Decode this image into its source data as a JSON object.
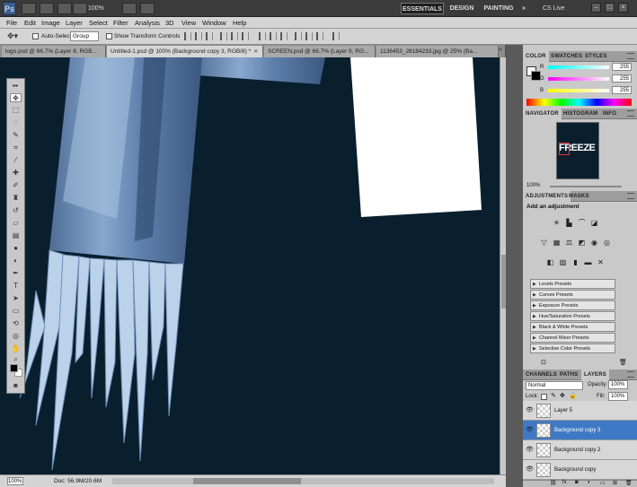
{
  "app": {
    "logo": "Ps"
  },
  "titlebar": {
    "zoom": "100%",
    "workspaces": [
      "ESSENTIALS",
      "DESIGN",
      "PAINTING",
      "»"
    ],
    "cs_live": "CS Live"
  },
  "menu": [
    "File",
    "Edit",
    "Image",
    "Layer",
    "Select",
    "Filter",
    "Analysis",
    "3D",
    "View",
    "Window",
    "Help"
  ],
  "options": {
    "auto_select_label": "Auto-Select:",
    "auto_select_value": "Group",
    "show_transform_label": "Show Transform Controls"
  },
  "doc_tabs": [
    {
      "label": "logo.psd @ 66.7% (Layer 8, RGB...",
      "active": false
    },
    {
      "label": "Untitled-1.psd @ 100% (Background copy 3, RGB/8) *",
      "active": true
    },
    {
      "label": "SCREEN.psd @ 66.7% (Layer 9, RG...",
      "active": false
    },
    {
      "label": "1136453_28184233.jpg @ 25% (Ba...",
      "active": false
    }
  ],
  "status": {
    "zoom": "100%",
    "doc_size": "Doc: 56.9M/20.6M"
  },
  "color_panel": {
    "tabs": [
      "COLOR",
      "SWATCHES",
      "STYLES"
    ],
    "channels": [
      {
        "label": "R",
        "value": "255"
      },
      {
        "label": "G",
        "value": "255"
      },
      {
        "label": "B",
        "value": "255"
      }
    ]
  },
  "navigator": {
    "tabs": [
      "NAVIGATOR",
      "HISTOGRAM",
      "INFO"
    ],
    "zoom": "100%",
    "preview_text": "FREEZE"
  },
  "adjustments": {
    "tabs": [
      "ADJUSTMENTS",
      "MASKS"
    ],
    "title": "Add an adjustment",
    "presets": [
      "Levels Presets",
      "Curves Presets",
      "Exposure Presets",
      "Hue/Saturation Presets",
      "Black & White Presets",
      "Channel Mixer Presets",
      "Selective Color Presets"
    ]
  },
  "layers": {
    "tabs": [
      "CHANNELS",
      "PATHS",
      "LAYERS"
    ],
    "blend_mode": "Normal",
    "opacity_label": "Opacity:",
    "opacity": "100%",
    "lock_label": "Lock:",
    "fill_label": "Fill:",
    "fill": "100%",
    "items": [
      {
        "name": "Layer 5",
        "selected": false
      },
      {
        "name": "Background copy 3",
        "selected": true
      },
      {
        "name": "Background copy 2",
        "selected": false
      },
      {
        "name": "Background copy",
        "selected": false
      }
    ]
  },
  "colors": {
    "canvas_bg": "#0a1f2e",
    "accent": "#3f79c6"
  }
}
